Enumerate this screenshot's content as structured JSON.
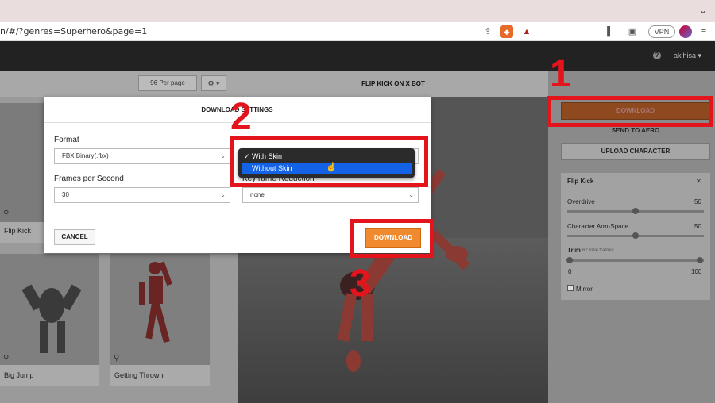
{
  "browser": {
    "url": "n/#/?genres=Superhero&page=1",
    "vpn_label": "VPN",
    "menu_chevron": "chevron-down-icon"
  },
  "app": {
    "help_icon": "?",
    "user": "akihisa ▾"
  },
  "library": {
    "per_page": "96 Per page",
    "gear_label": "⚙ ▾",
    "cards": [
      {
        "name": "Flip Kick"
      },
      {
        "name": "Big Jump"
      },
      {
        "name": "Getting Thrown"
      }
    ]
  },
  "viewer": {
    "title": "FLIP KICK ON X BOT"
  },
  "right_panel": {
    "download_label": "DOWNLOAD",
    "send_label": "SEND TO AERO",
    "upload_label": "UPLOAD CHARACTER",
    "panel_title": "Flip Kick",
    "close": "✕",
    "overdrive_label": "Overdrive",
    "overdrive_value": "50",
    "arm_label": "Character Arm-Space",
    "arm_value": "50",
    "trim_label": "Trim",
    "trim_frames": "62 total frames",
    "trim_min": "0",
    "trim_max": "100",
    "mirror_label": "Mirror",
    "overdrive_level": 0.5,
    "arm_level": 0.5
  },
  "modal": {
    "title": "DOWNLOAD SETTINGS",
    "format_label": "Format",
    "format_value": "FBX Binary(.fbx)",
    "fps_label": "Frames per Second",
    "fps_value": "30",
    "keyframe_label": "Keyframe Reduction",
    "keyframe_value": "none",
    "cancel_label": "CANCEL",
    "download_label": "DOWNLOAD"
  },
  "dropdown": {
    "options": [
      "✓ With Skin",
      "Without Skin"
    ],
    "selected_index": 1
  },
  "annotations": {
    "step1": "1",
    "step2": "2",
    "step3": "3",
    "color": "#e4141c"
  }
}
